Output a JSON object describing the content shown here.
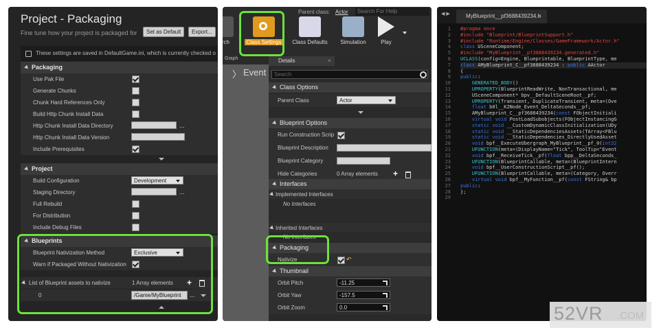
{
  "left": {
    "title": "Project - Packaging",
    "subtitle": "Fine tune how your project is packaged for",
    "set_default_label": "Set as Default",
    "export_label": "Export...",
    "info_text": "These settings are saved in DefaultGame.ini, which is currently checked o",
    "packaging": {
      "header": "Packaging",
      "use_pak": "Use Pak File",
      "gen_chunks": "Generate Chunks",
      "chunk_hard": "Chunk Hard References Only",
      "build_http": "Build Http Chunk Install Data",
      "http_dir": "Http Chunk Install Data Directory",
      "http_ver": "Http Chunk Install Data Version",
      "include_prereq": "Include Prerequisites"
    },
    "project": {
      "header": "Project",
      "build_config": "Build Configuration",
      "build_config_value": "Development",
      "staging_dir": "Staging Directory",
      "full_rebuild": "Full Rebuild",
      "for_distribution": "For Distribution",
      "include_debug": "Include Debug Files"
    },
    "blueprints": {
      "header": "Blueprints",
      "method_label": "Blueprint Nativization Method",
      "method_value": "Exclusive",
      "warn_label": "Warn if Packaged Without Nativization",
      "list_label": "List of Blueprint assets to nativize",
      "list_count": "1 Array elements",
      "index": "0",
      "asset_path": "/Game/MyBlueprint"
    },
    "dots": "..."
  },
  "middle": {
    "parent_class_label": "Parent class:",
    "parent_class_value": "Actor",
    "search_help": "Search For Help",
    "search_partial": "earch",
    "class_settings": "Class Settings",
    "class_defaults": "Class Defaults",
    "simulation": "Simulation",
    "play": "Play",
    "graph_tab": "Graph",
    "event_text": "Event",
    "details_tab": "Details",
    "search_placeholder": "Search",
    "class_options": {
      "header": "Class Options",
      "parent_label": "Parent Class",
      "parent_value": "Actor"
    },
    "bp_options": {
      "header": "Blueprint Options",
      "run_construction": "Run Construction Scrip",
      "description": "Blueprint Description",
      "category": "Blueprint Category",
      "hide_categories": "Hide Categories",
      "hide_count": "0 Array elements"
    },
    "interfaces": {
      "header": "Interfaces",
      "implemented": "Implemented Interfaces",
      "no_impl": "No Interfaces",
      "inherited": "Inherited Interfaces",
      "no_inh": "No Interfaces"
    },
    "packaging": {
      "header": "Packaging",
      "nativize": "Nativize"
    },
    "thumbnail": {
      "header": "Thumbnail",
      "pitch_label": "Orbit Pitch",
      "pitch": "-11.25",
      "yaw_label": "Orbit Yaw",
      "yaw": "-157.5",
      "zoom_label": "Orbit Zoom",
      "zoom": "0.0"
    }
  },
  "right": {
    "tab_label": "MyBlueprint__pf3688439234.h",
    "close": "×",
    "line_numbers": [
      "1",
      "2",
      "3",
      "4",
      "5",
      "6",
      "7",
      "8",
      "9",
      "10",
      "11",
      "12",
      "13",
      "14",
      "15",
      "16",
      "17",
      "18",
      "19",
      "20",
      "21",
      "22",
      "23",
      "24",
      "25",
      "26",
      "27",
      "28",
      "29"
    ],
    "code_lines": [
      "#pragma once",
      "#include \"Blueprint/BlueprintSupport.h\"",
      "#include \"Runtime/Engine/Classes/GameFramework/Actor.h\"",
      "class USceneComponent;",
      "#include \"MyBlueprint__pf3688439234.generated.h\"",
      "UCLASS(config=Engine, Blueprintable, BlueprintType, me",
      "class AMyBlueprint_C__pf3688439234 : public AActor",
      "{",
      "public:",
      "    GENERATED_BODY()",
      "    UPROPERTY(BlueprintReadWrite, NonTransactional, me",
      "    USceneComponent* bpv__DefaultSceneRoot__pf;",
      "    UPROPERTY(Transient, DuplicateTransient, meta=(Ove",
      "    float b0l__K2Node_Event_DeltaSeconds__pf;",
      "    AMyBlueprint_C__pf3688439234(const FObjectInitiali",
      "    virtual void PostLoadSubobjects(FObjectInstancingG",
      "    static void __CustomDynamicClassInitialization(UDy",
      "    static void __StaticDependenciesAssets(TArray<FBlu",
      "    static void __StaticDependencies_DirectlyUsedAsset",
      "    void bpf__ExecuteUbergraph_MyBlueprint__pf_0(int32",
      "    UFUNCTION(meta=(DisplayName=\"Tick\", ToolTip=\"Event",
      "    void bpf__ReceiveTick__pf(float bpp__DeltaSeconds_",
      "    UFUNCTION(BlueprintCallable, meta=(BlueprintIntern",
      "    void bpf__UserConstructionScript__pf();",
      "    UFUNCTION(BlueprintCallable, meta=(Category, Overr",
      "    virtual void bpf__MyFunction__pf(const FString& bp",
      "public:",
      "};",
      ""
    ]
  },
  "watermark": {
    "main": "52VR",
    "sub": ".COM"
  }
}
